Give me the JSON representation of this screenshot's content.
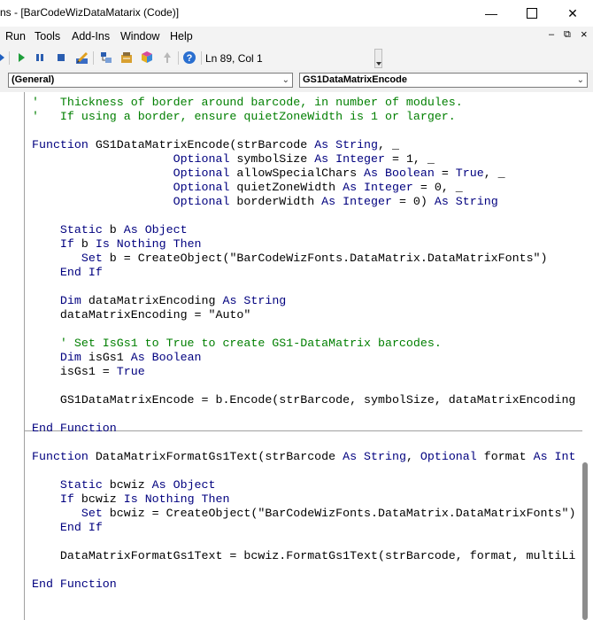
{
  "window": {
    "title": "ns - [BarCodeWizDataMatarix (Code)]",
    "min_glyph": "—",
    "close_glyph": "✕"
  },
  "menu": {
    "items": [
      "Run",
      "Tools",
      "Add-Ins",
      "Window",
      "Help"
    ],
    "mdi_min": "–",
    "mdi_restore": "⧉",
    "mdi_close": "×"
  },
  "toolbar": {
    "cursor_position": "Ln 89, Col 1",
    "icons": [
      "insert-module-icon",
      "run-icon",
      "break-icon",
      "reset-icon",
      "design-mode-icon",
      "project-explorer-icon",
      "properties-window-icon",
      "object-browser-icon",
      "toolbox-icon",
      "help-icon"
    ]
  },
  "combos": {
    "object": "(General)",
    "procedure": "GS1DataMatrixEncode"
  },
  "colors": {
    "keyword": "#00007f",
    "comment": "#007f00",
    "text": "#000000"
  },
  "code": [
    [
      [
        "cm",
        "'   Thickness of border around barcode, in number of modules."
      ]
    ],
    [
      [
        "cm",
        "'   If using a border, ensure quietZoneWidth is 1 or larger."
      ]
    ],
    [],
    [
      [
        "kw",
        "Function"
      ],
      [
        "tx",
        " GS1DataMatrixEncode(strBarcode "
      ],
      [
        "kw",
        "As String"
      ],
      [
        "tx",
        ", _"
      ]
    ],
    [
      [
        "tx",
        "                    "
      ],
      [
        "kw",
        "Optional"
      ],
      [
        "tx",
        " symbolSize "
      ],
      [
        "kw",
        "As Integer"
      ],
      [
        "tx",
        " = 1, _"
      ]
    ],
    [
      [
        "tx",
        "                    "
      ],
      [
        "kw",
        "Optional"
      ],
      [
        "tx",
        " allowSpecialChars "
      ],
      [
        "kw",
        "As Boolean"
      ],
      [
        "tx",
        " = "
      ],
      [
        "kw",
        "True"
      ],
      [
        "tx",
        ", _"
      ]
    ],
    [
      [
        "tx",
        "                    "
      ],
      [
        "kw",
        "Optional"
      ],
      [
        "tx",
        " quietZoneWidth "
      ],
      [
        "kw",
        "As Integer"
      ],
      [
        "tx",
        " = 0, _"
      ]
    ],
    [
      [
        "tx",
        "                    "
      ],
      [
        "kw",
        "Optional"
      ],
      [
        "tx",
        " borderWidth "
      ],
      [
        "kw",
        "As Integer"
      ],
      [
        "tx",
        " = 0) "
      ],
      [
        "kw",
        "As String"
      ]
    ],
    [],
    [
      [
        "tx",
        "    "
      ],
      [
        "kw",
        "Static"
      ],
      [
        "tx",
        " b "
      ],
      [
        "kw",
        "As Object"
      ]
    ],
    [
      [
        "tx",
        "    "
      ],
      [
        "kw",
        "If"
      ],
      [
        "tx",
        " b "
      ],
      [
        "kw",
        "Is Nothing Then"
      ]
    ],
    [
      [
        "tx",
        "       "
      ],
      [
        "kw",
        "Set"
      ],
      [
        "tx",
        " b = CreateObject(\"BarCodeWizFonts.DataMatrix.DataMatrixFonts\")"
      ]
    ],
    [
      [
        "tx",
        "    "
      ],
      [
        "kw",
        "End If"
      ]
    ],
    [],
    [
      [
        "tx",
        "    "
      ],
      [
        "kw",
        "Dim"
      ],
      [
        "tx",
        " dataMatrixEncoding "
      ],
      [
        "kw",
        "As String"
      ]
    ],
    [
      [
        "tx",
        "    dataMatrixEncoding = \"Auto\""
      ]
    ],
    [],
    [
      [
        "tx",
        "    "
      ],
      [
        "cm",
        "' Set IsGs1 to True to create GS1-DataMatrix barcodes."
      ]
    ],
    [
      [
        "tx",
        "    "
      ],
      [
        "kw",
        "Dim"
      ],
      [
        "tx",
        " isGs1 "
      ],
      [
        "kw",
        "As Boolean"
      ]
    ],
    [
      [
        "tx",
        "    isGs1 = "
      ],
      [
        "kw",
        "True"
      ]
    ],
    [],
    [
      [
        "tx",
        "    GS1DataMatrixEncode = b.Encode(strBarcode, symbolSize, dataMatrixEncoding"
      ]
    ],
    [],
    [
      [
        "kw",
        "End Function"
      ]
    ],
    [],
    [
      [
        "kw",
        "Function"
      ],
      [
        "tx",
        " DataMatrixFormatGs1Text(strBarcode "
      ],
      [
        "kw",
        "As String"
      ],
      [
        "tx",
        ", "
      ],
      [
        "kw",
        "Optional"
      ],
      [
        "tx",
        " format "
      ],
      [
        "kw",
        "As Int"
      ]
    ],
    [],
    [
      [
        "tx",
        "    "
      ],
      [
        "kw",
        "Static"
      ],
      [
        "tx",
        " bcwiz "
      ],
      [
        "kw",
        "As Object"
      ]
    ],
    [
      [
        "tx",
        "    "
      ],
      [
        "kw",
        "If"
      ],
      [
        "tx",
        " bcwiz "
      ],
      [
        "kw",
        "Is Nothing Then"
      ]
    ],
    [
      [
        "tx",
        "       "
      ],
      [
        "kw",
        "Set"
      ],
      [
        "tx",
        " bcwiz = CreateObject(\"BarCodeWizFonts.DataMatrix.DataMatrixFonts\")"
      ]
    ],
    [
      [
        "tx",
        "    "
      ],
      [
        "kw",
        "End If"
      ]
    ],
    [],
    [
      [
        "tx",
        "    DataMatrixFormatGs1Text = bcwiz.FormatGs1Text(strBarcode, format, multiLi"
      ]
    ],
    [],
    [
      [
        "kw",
        "End Function"
      ]
    ]
  ]
}
